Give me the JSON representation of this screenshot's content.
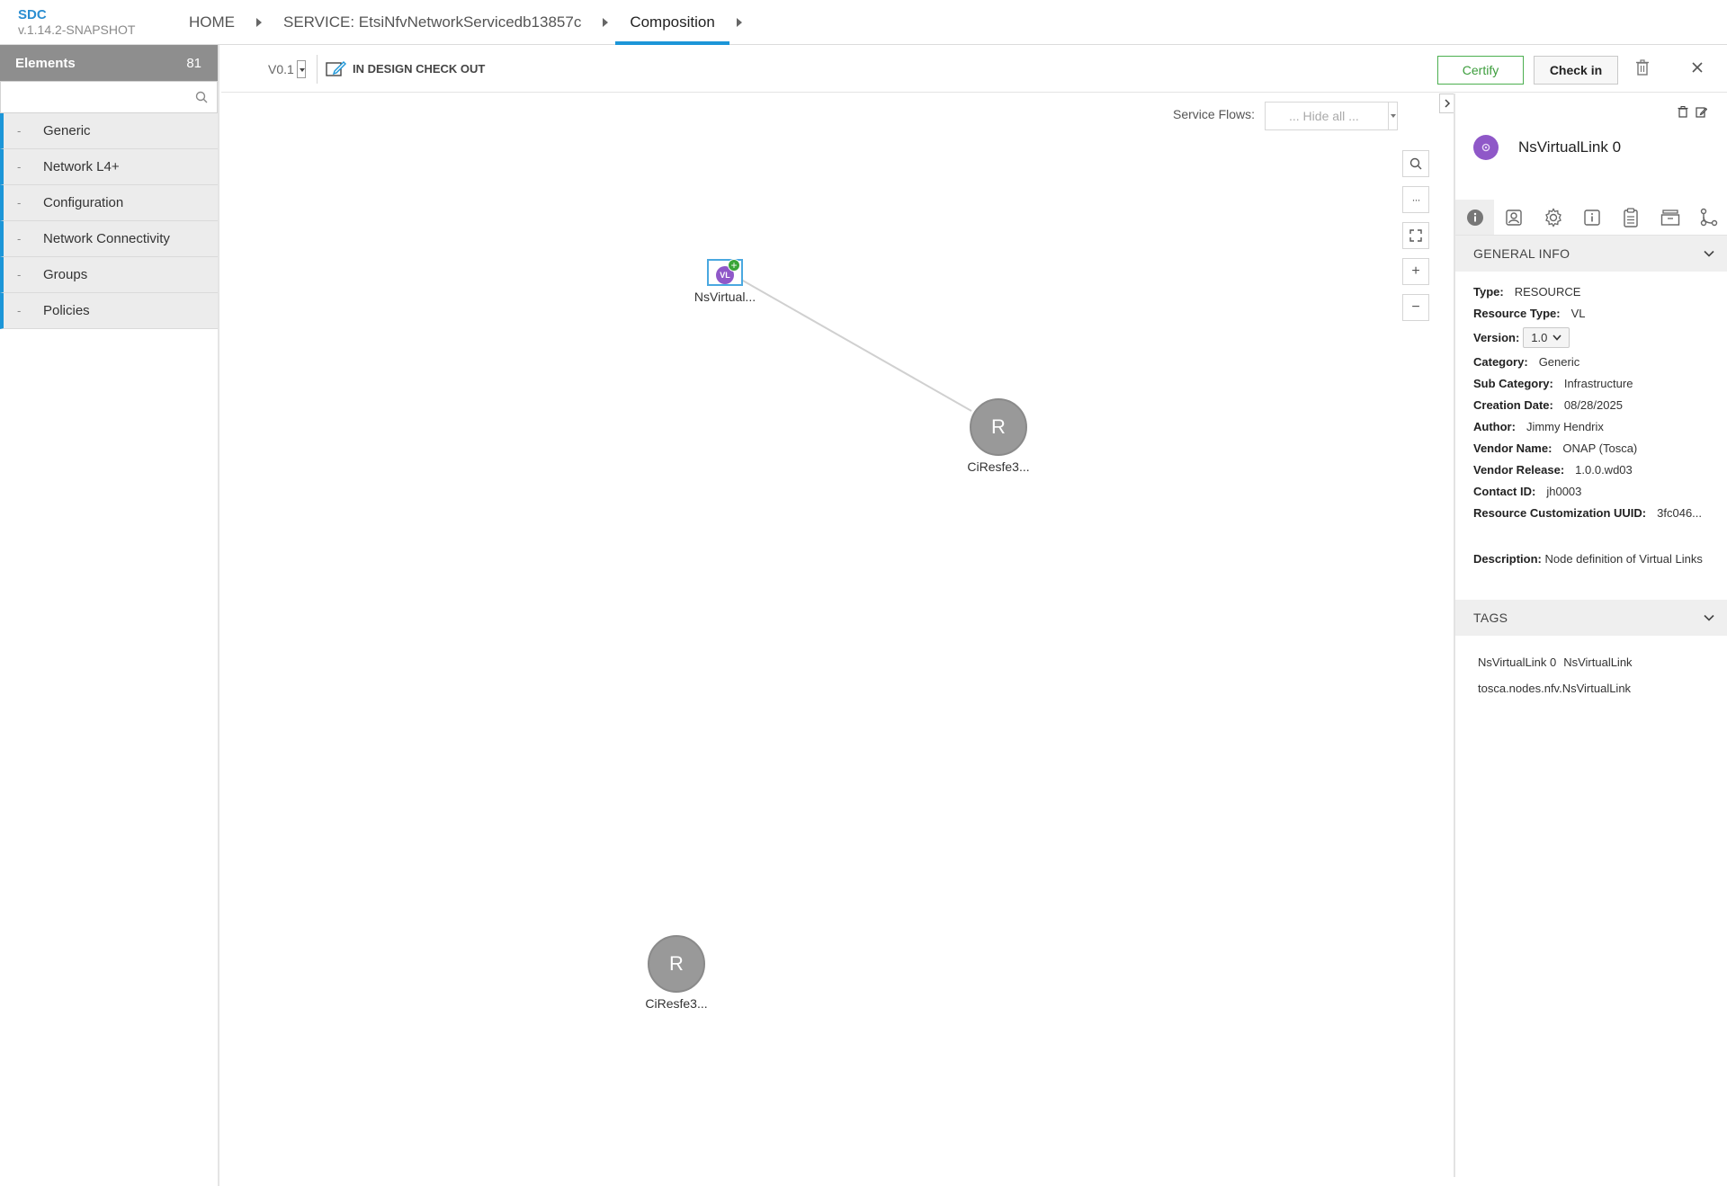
{
  "app": {
    "name": "SDC",
    "version": "v.1.14.2-SNAPSHOT"
  },
  "breadcrumbs": [
    {
      "label": "HOME"
    },
    {
      "label": "SERVICE: EtsiNfvNetworkServicedb13857c"
    },
    {
      "label": "Composition"
    }
  ],
  "left_panel": {
    "title": "Elements",
    "count": "81",
    "search": {
      "placeholder": "",
      "value": ""
    },
    "categories": [
      {
        "label": "Generic"
      },
      {
        "label": "Network L4+"
      },
      {
        "label": "Configuration"
      },
      {
        "label": "Network Connectivity"
      },
      {
        "label": "Groups"
      },
      {
        "label": "Policies"
      }
    ],
    "category_marker": "-"
  },
  "toolbar": {
    "version": "V0.1",
    "status": "IN DESIGN CHECK OUT",
    "certify_label": "Certify",
    "checkin_label": "Check in"
  },
  "canvas": {
    "service_flows_label": "Service Flows:",
    "service_flows_value": "... Hide all ...",
    "nodes": [
      {
        "name": "NsVirtual...",
        "badge": "VL",
        "plus": "+"
      },
      {
        "name": "CiResfe3...",
        "letter": "R"
      },
      {
        "name": "CiResfe3...",
        "letter": "R"
      }
    ],
    "zoom_controls": {
      "more": "···",
      "zoom_in": "+",
      "zoom_out": "−"
    }
  },
  "right_panel": {
    "title": "NsVirtualLink 0",
    "general_info_title": "GENERAL INFO",
    "fields": [
      {
        "label": "Type:",
        "value": "RESOURCE"
      },
      {
        "label": "Resource Type:",
        "value": "VL"
      },
      {
        "label": "Version:",
        "value": "1.0"
      },
      {
        "label": "Category:",
        "value": "Generic"
      },
      {
        "label": "Sub Category:",
        "value": "Infrastructure"
      },
      {
        "label": "Creation Date:",
        "value": "08/28/2025"
      },
      {
        "label": "Author:",
        "value": "Jimmy Hendrix"
      },
      {
        "label": "Vendor Name:",
        "value": "ONAP (Tosca)"
      },
      {
        "label": "Vendor Release:",
        "value": "1.0.0.wd03"
      },
      {
        "label": "Contact ID:",
        "value": "jh0003"
      },
      {
        "label": "Resource Customization UUID:",
        "value": "3fc046..."
      }
    ],
    "description_label": "Description:",
    "description_value": "Node definition of Virtual Links",
    "tags_title": "TAGS",
    "tags": [
      "NsVirtualLink 0",
      "NsVirtualLink",
      "tosca.nodes.nfv.NsVirtualLink"
    ]
  },
  "colors": {
    "accent": "#1c96d8",
    "certify": "#3c9d3c",
    "vl_node": "#8f58c8",
    "resource_node": "#999999",
    "add_badge": "#3aa537"
  }
}
